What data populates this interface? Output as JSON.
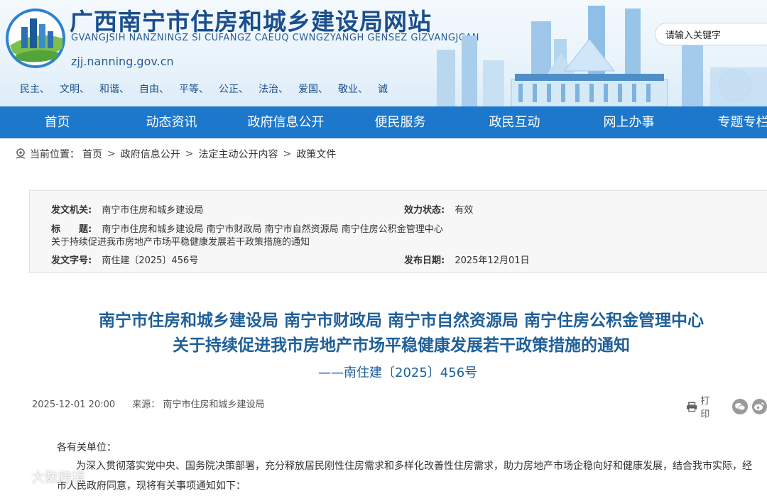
{
  "header": {
    "title": "广西南宁市住房和城乡建设局网站",
    "subtitle": "GVANGJSIH NANZNINGZ SI CUFANGZ CAEUQ CWNGZYANGH GENSEZ GIZVANGJCAN",
    "domain": "zjj.nanning.gov.cn",
    "values": [
      "民主、",
      "文明、",
      "和谐、",
      "自由、",
      "平等、",
      "公正、",
      "法治、",
      "爱国、",
      "敬业、",
      "诚"
    ],
    "search_placeholder": "请输入关键字"
  },
  "nav": {
    "items": [
      "首页",
      "动态资讯",
      "政府信息公开",
      "便民服务",
      "政民互动",
      "网上办事",
      "专题专栏"
    ]
  },
  "breadcrumb": {
    "label": "当前位置：",
    "items": [
      "首页",
      "政府信息公开",
      "法定主动公开内容",
      "政策文件"
    ]
  },
  "meta": {
    "issuer_label": "发文机关:",
    "issuer": "南宁市住房和城乡建设局",
    "status_label": "效力状态:",
    "status": "有效",
    "title_label": "标　　题:",
    "title_line1": "南宁市住房和城乡建设局 南宁市财政局 南宁市自然资源局 南宁住房公积金管理中心",
    "title_line2": "关于持续促进我市房地产市场平稳健康发展若干政策措施的通知",
    "number_label": "发文字号:",
    "number": "南住建〔2025〕456号",
    "date_label": "发布日期:",
    "date": "2025年12月01日"
  },
  "document": {
    "title_line1": "南宁市住房和城乡建设局 南宁市财政局 南宁市自然资源局 南宁住房公积金管理中心",
    "title_line2": "关于持续促进我市房地产市场平稳健康发展若干政策措施的通知",
    "doc_number": "——南住建〔2025〕456号",
    "datetime": "2025-12-01 20:00",
    "source_label": "来源：",
    "source": "南宁市住房和城乡建设局",
    "print_label": "打印",
    "greeting": "各有关单位：",
    "paragraph": "为深入贯彻落实党中央、国务院决策部署，充分释放居民刚性住房需求和多样化改善性住房需求，助力房地产市场企稳向好和健康发展，结合我市实际，经市人民政府同意，现将有关事项通知如下："
  },
  "watermark": "大数跨境",
  "colors": {
    "nav_bg": "#1d78cc",
    "title_blue": "#1f5f99",
    "header_blue": "#1a4e8c"
  }
}
